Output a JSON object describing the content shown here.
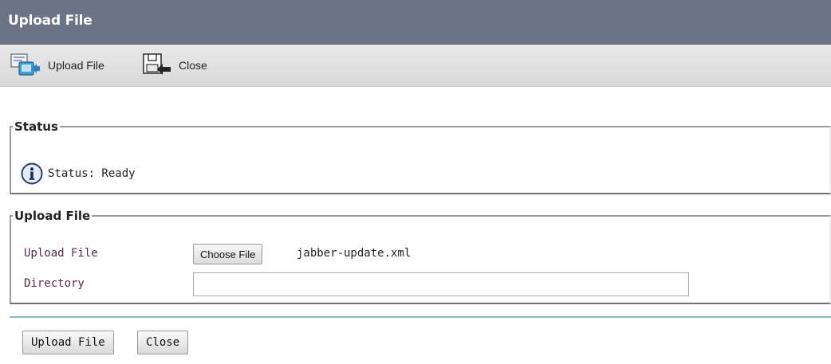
{
  "window": {
    "title": "Upload File"
  },
  "toolbar": {
    "upload_label": "Upload File",
    "upload_icon": "upload-file-icon",
    "close_label": "Close",
    "close_icon": "close-window-icon"
  },
  "status": {
    "legend": "Status",
    "icon": "info-icon",
    "text": "Status: Ready"
  },
  "upload": {
    "legend": "Upload File",
    "file_label": "Upload File",
    "choose_button": "Choose File",
    "file_name": "jabber-update.xml",
    "directory_label": "Directory",
    "directory_value": ""
  },
  "buttons": {
    "upload": "Upload File",
    "close": "Close"
  },
  "colors": {
    "title_bar": "#6a7486",
    "label_text": "#5a2a48",
    "divider": "#8fb4c2"
  }
}
